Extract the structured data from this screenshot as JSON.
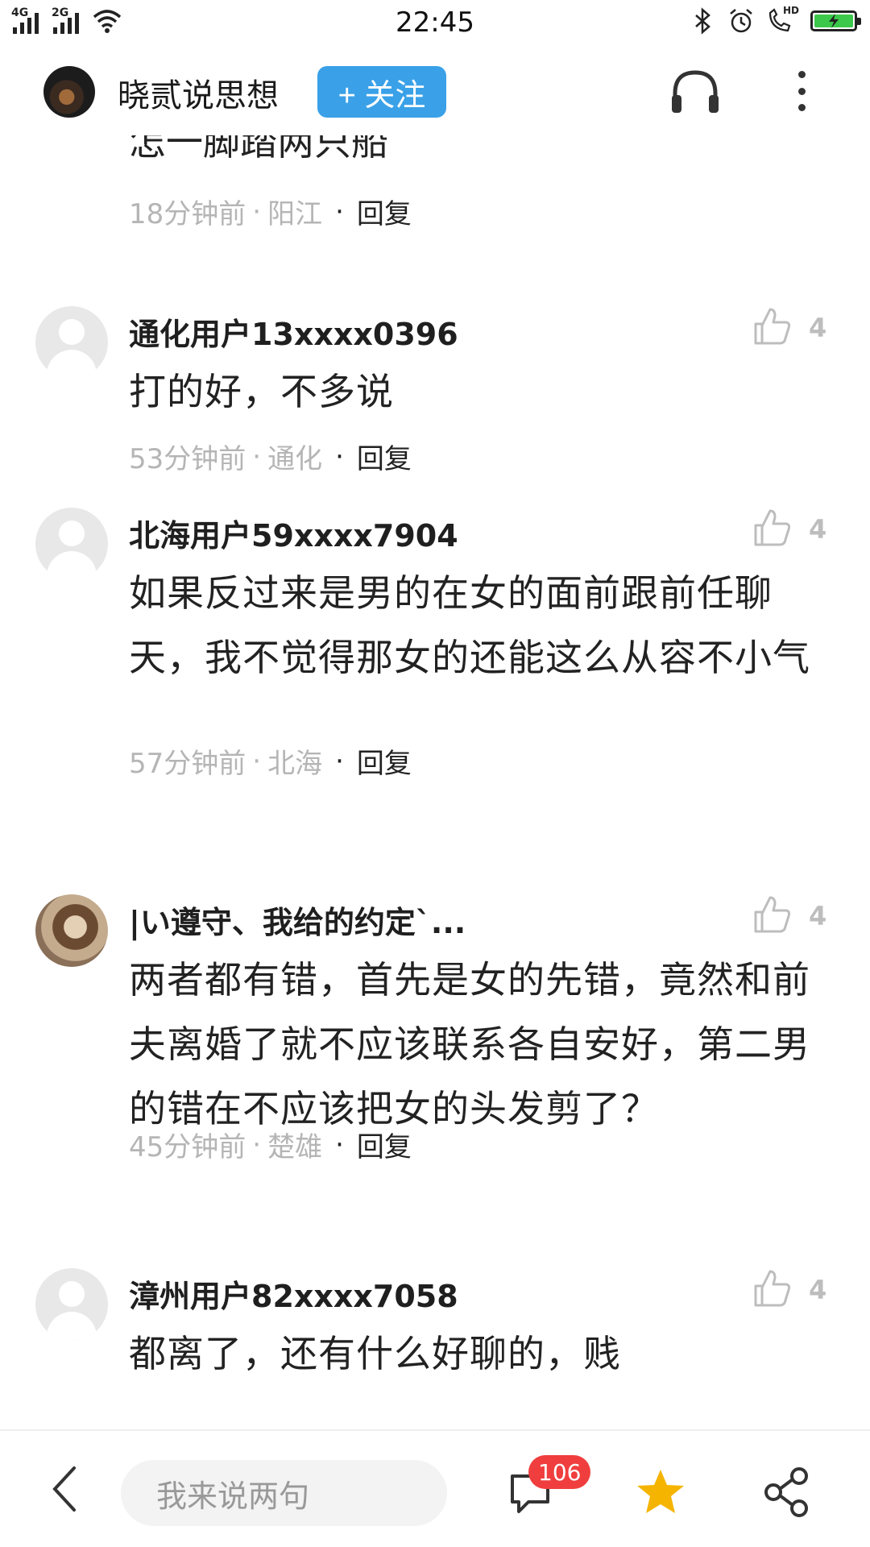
{
  "status_bar": {
    "net1": "4G",
    "net2": "2G",
    "time": "22:45",
    "hd": "HD"
  },
  "header": {
    "author": "晓贰说思想",
    "follow_label": "+ 关注"
  },
  "partial_comment": {
    "text": "怎一脚踏两只船",
    "time": "18分钟前",
    "location": "阳江",
    "reply_label": "回复"
  },
  "comments": [
    {
      "name": "通化用户13xxxx0396",
      "likes": "4",
      "text": "打的好，不多说",
      "time": "53分钟前",
      "location": "通化",
      "reply_label": "回复"
    },
    {
      "name": "北海用户59xxxx7904",
      "likes": "4",
      "text": "如果反过来是男的在女的面前跟前任聊天，我不觉得那女的还能这么从容不小气",
      "time": "57分钟前",
      "location": "北海",
      "reply_label": "回复"
    },
    {
      "name": "|い遵守、我给的约定`...",
      "likes": "4",
      "text": "两者都有错，首先是女的先错，竟然和前夫离婚了就不应该联系各自安好，第二男的错在不应该把女的头发剪了？",
      "time": "45分钟前",
      "location": "楚雄",
      "reply_label": "回复"
    },
    {
      "name": "漳州用户82xxxx7058",
      "likes": "4",
      "text": "都离了，还有什么好聊的，贱"
    }
  ],
  "bottom_bar": {
    "input_placeholder": "我来说两句",
    "comment_count": "106"
  },
  "colors": {
    "accent": "#3aa1e8",
    "badge": "#f03e3e",
    "star": "#f5b400",
    "meta_gray": "#b5b5b5"
  },
  "icons": [
    "headphone-icon",
    "more-vertical-icon",
    "thumbs-up-icon",
    "back-arrow-icon",
    "comment-icon",
    "star-icon",
    "share-icon",
    "bluetooth-icon",
    "alarm-icon",
    "hd-call-icon",
    "battery-icon",
    "wifi-icon",
    "signal-icon"
  ]
}
